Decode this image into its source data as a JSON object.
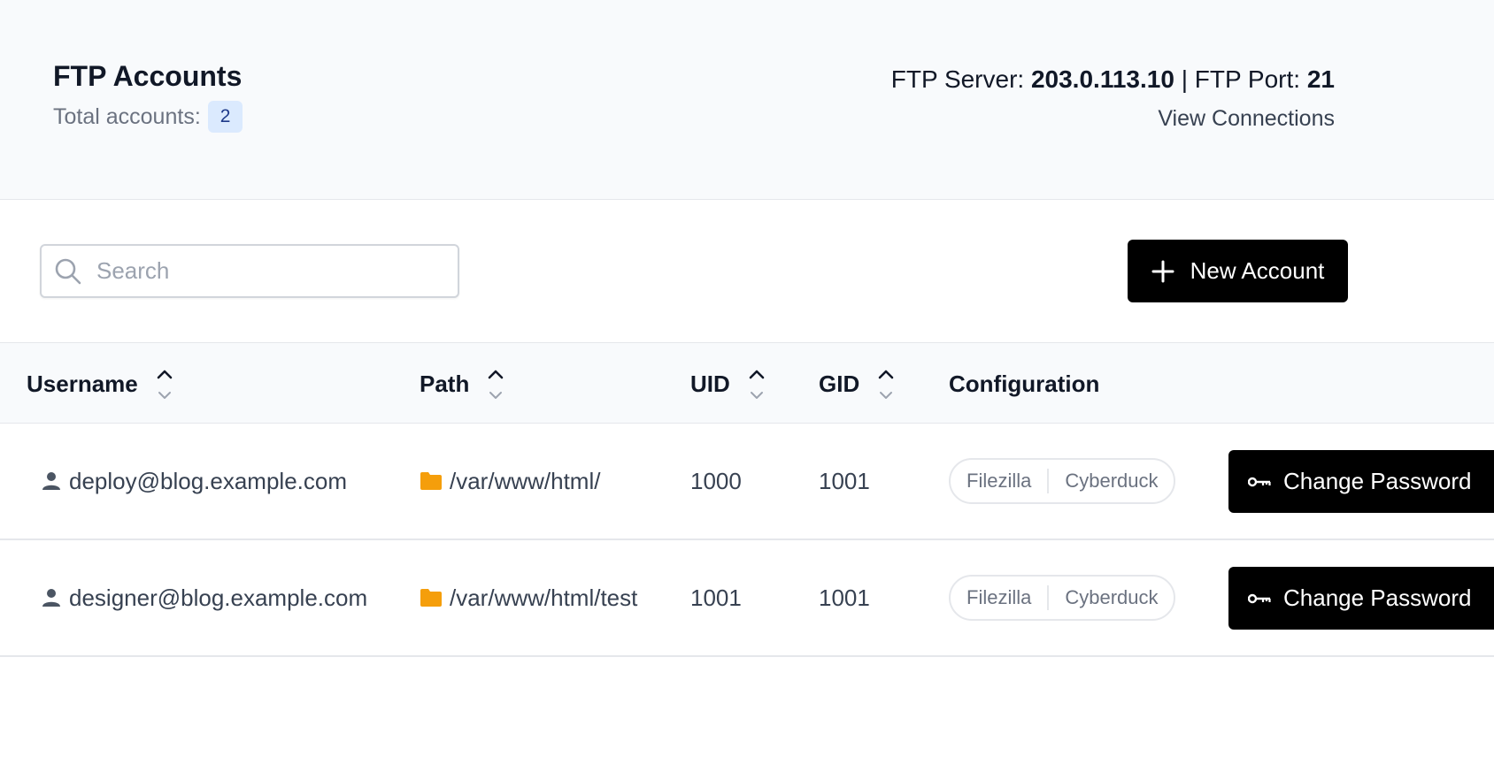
{
  "header": {
    "title": "FTP Accounts",
    "total_label": "Total accounts:",
    "total_count": "2",
    "server_label": "FTP Server:",
    "server_value": "203.0.113.10",
    "separator": "|",
    "port_label": "FTP Port:",
    "port_value": "21",
    "view_connections": "View Connections"
  },
  "toolbar": {
    "search_placeholder": "Search",
    "new_account_label": "New Account"
  },
  "table": {
    "columns": [
      "Username",
      "Path",
      "UID",
      "GID",
      "Configuration"
    ],
    "rows": [
      {
        "username": "deploy@blog.example.com",
        "path": "/var/www/html/",
        "uid": "1000",
        "gid": "1001",
        "config_1": "Filezilla",
        "config_2": "Cyberduck",
        "action": "Change Password"
      },
      {
        "username": "designer@blog.example.com",
        "path": "/var/www/html/test",
        "uid": "1001",
        "gid": "1001",
        "config_1": "Filezilla",
        "config_2": "Cyberduck",
        "action": "Change Password"
      }
    ]
  },
  "icons": {
    "user": "user-icon",
    "folder": "folder-icon",
    "key": "key-icon",
    "search": "search-icon",
    "plus": "plus-icon",
    "sort": "sort-icon"
  },
  "colors": {
    "folder": "#f59e0b",
    "button": "#000000",
    "badge_bg": "#dbeafe",
    "header_bg": "#f8fafc"
  }
}
